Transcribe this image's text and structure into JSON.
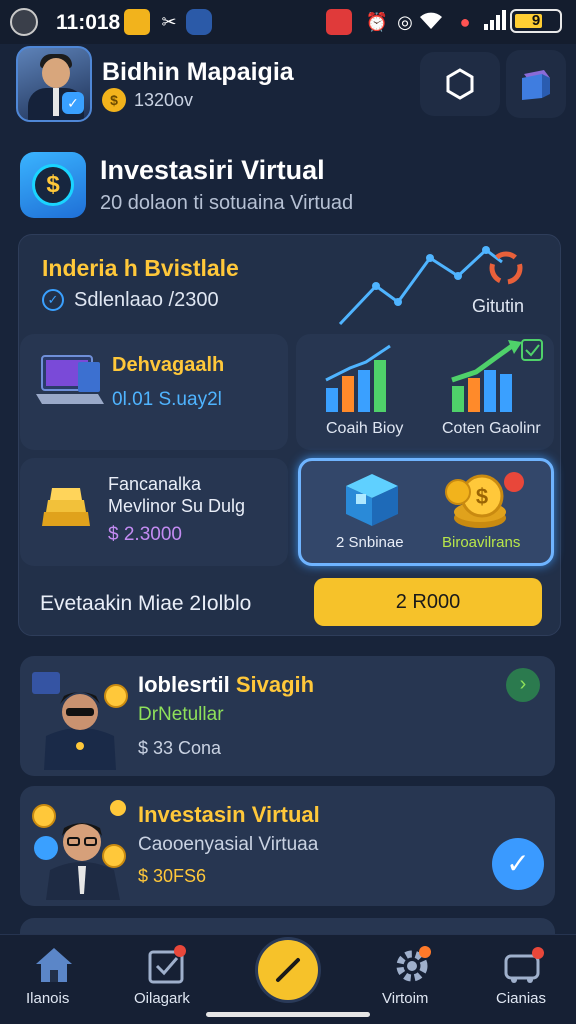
{
  "status_bar": {
    "time": "11:018",
    "battery_label": "9",
    "battery_level": 0.62,
    "icons": [
      "app-ring-icon",
      "notification-square-icon",
      "tools-icon",
      "puzzle-icon",
      "record-icon",
      "alarm-icon",
      "location-icon",
      "wifi-icon",
      "pin-icon",
      "signal-icon"
    ]
  },
  "profile": {
    "name": "Bidhin Mapaigia",
    "coin_amount": "1320ov"
  },
  "header": {
    "title": "Investasiri Virtual",
    "subtitle": "20 dolaon ti sotuaina Virtuad"
  },
  "dashboard": {
    "main_title": "Inderia h Bvistlale",
    "main_sub": "Sdlenlaao /2300",
    "graph_label": "Gitutin",
    "tile_laptop": {
      "title": "Dehvagaalh",
      "value": "0l.01 S.uay2l"
    },
    "tile_chart_left": "Coaih Bioy",
    "tile_chart_right": "Coten Gaolinr",
    "tile_gold": {
      "line1": "Fancanalka",
      "line2": "Mevlinor Su Dulg",
      "amount": "$ 2.3000"
    },
    "tile_highlight_left": "2 Snbinae",
    "tile_highlight_right": "Biroavilrans",
    "footer_text": "Evetaakin Miae 2Iolblo",
    "cta_label": "2 R000"
  },
  "list": [
    {
      "title_white": "Ioblesrtil",
      "title_yellow": "Sivagih",
      "subtitle": "DrNetullar",
      "amount": "$ 33 Cona"
    },
    {
      "title": "Investasin Virtual",
      "subtitle": "Caooenyasial Virtuaa",
      "amount": "$ 30FS6"
    }
  ],
  "nav": {
    "items": [
      "Ilanois",
      "Oilagark",
      "Virtoim",
      "Cianias"
    ]
  },
  "colors": {
    "background": "#18243a",
    "card": "#273651",
    "accent_yellow": "#ffc83a",
    "accent_green": "#8ee05a",
    "accent_blue": "#3aa0ff",
    "button_yellow": "#f6c22a"
  }
}
